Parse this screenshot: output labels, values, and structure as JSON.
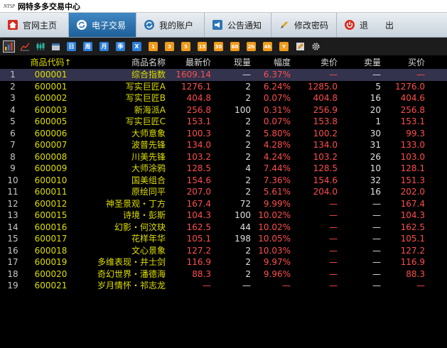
{
  "window": {
    "logo_text": "NTSP",
    "title": "网特多多交易中心"
  },
  "nav": {
    "tabs": [
      {
        "label": "官网主页",
        "icon": "home-icon"
      },
      {
        "label": "电子交易",
        "icon": "refresh-icon"
      },
      {
        "label": "我的账户",
        "icon": "refresh-icon"
      },
      {
        "label": "公告通知",
        "icon": "announcement-icon"
      },
      {
        "label": "修改密码",
        "icon": "pen-icon"
      },
      {
        "label": "退　　出",
        "icon": "power-icon"
      }
    ],
    "active_tab": "电子交易"
  },
  "toolbar": {
    "icons": [
      "bar-chart-icon",
      "line-chart-icon",
      "candlestick-icon",
      "calendar-icon"
    ],
    "period_buttons": [
      "日",
      "周",
      "月",
      "季",
      "X"
    ],
    "minute_buttons": [
      "1",
      "3",
      "5",
      "15",
      "30",
      "60",
      "2h",
      "4h",
      "Y"
    ],
    "tools": [
      "edit-icon",
      "settings-icon"
    ]
  },
  "table": {
    "headers": [
      "",
      "商品代码↑",
      "商品名称",
      "最新价",
      "现量",
      "幅度",
      "卖价",
      "卖量",
      "买价"
    ],
    "rows": [
      [
        "1",
        "000001",
        "综合指数",
        "1609.14",
        "—",
        "6.37%",
        "—",
        "—",
        "—"
      ],
      [
        "2",
        "600001",
        "写实巨匠A",
        "1276.1",
        "2",
        "6.24%",
        "1285.0",
        "5",
        "1276.0"
      ],
      [
        "3",
        "600002",
        "写实巨匠B",
        "404.8",
        "2",
        "0.07%",
        "404.8",
        "16",
        "404.6"
      ],
      [
        "4",
        "600003",
        "新海派A",
        "256.8",
        "100",
        "0.31%",
        "256.9",
        "20",
        "256.8"
      ],
      [
        "5",
        "600005",
        "写实巨匠C",
        "153.1",
        "2",
        "0.07%",
        "153.8",
        "1",
        "153.1"
      ],
      [
        "6",
        "600006",
        "大师意象",
        "100.3",
        "2",
        "5.80%",
        "100.2",
        "30",
        "99.3"
      ],
      [
        "7",
        "600007",
        "波普先锋",
        "134.0",
        "2",
        "4.28%",
        "134.0",
        "31",
        "133.0"
      ],
      [
        "8",
        "600008",
        "川美先锋",
        "103.2",
        "2",
        "4.24%",
        "103.2",
        "26",
        "103.0"
      ],
      [
        "9",
        "600009",
        "大师涂鸦",
        "128.5",
        "4",
        "7.44%",
        "128.5",
        "10",
        "128.1"
      ],
      [
        "10",
        "600010",
        "国美组合",
        "154.6",
        "2",
        "7.36%",
        "154.6",
        "32",
        "151.3"
      ],
      [
        "11",
        "600011",
        "原绘同平",
        "207.0",
        "2",
        "5.61%",
        "204.0",
        "16",
        "202.0"
      ],
      [
        "12",
        "600012",
        "神圣景观・丁方",
        "167.4",
        "72",
        "9.99%",
        "—",
        "—",
        "167.4"
      ],
      [
        "13",
        "600015",
        "诗境・彭斯",
        "104.3",
        "100",
        "10.02%",
        "—",
        "—",
        "104.3"
      ],
      [
        "14",
        "600016",
        "幻影・何汶玦",
        "162.5",
        "44",
        "10.02%",
        "—",
        "—",
        "162.5"
      ],
      [
        "15",
        "600017",
        "花样年华",
        "105.1",
        "198",
        "10.05%",
        "—",
        "—",
        "105.1"
      ],
      [
        "16",
        "600018",
        "文心景象",
        "127.2",
        "2",
        "10.03%",
        "—",
        "—",
        "127.2"
      ],
      [
        "17",
        "600019",
        "多维表现・井士剑",
        "116.9",
        "2",
        "9.97%",
        "—",
        "—",
        "116.9"
      ],
      [
        "18",
        "600020",
        "奇幻世界・潘德海",
        "88.3",
        "2",
        "9.96%",
        "—",
        "—",
        "88.3"
      ],
      [
        "19",
        "600021",
        "岁月情怀・祁志龙",
        "—",
        "—",
        "—",
        "—",
        "—",
        "—"
      ]
    ]
  },
  "colors": {
    "background": "#000000",
    "code": "#dede00",
    "price_up": "#ff4d4d",
    "active_tab": "#2d74b4"
  }
}
